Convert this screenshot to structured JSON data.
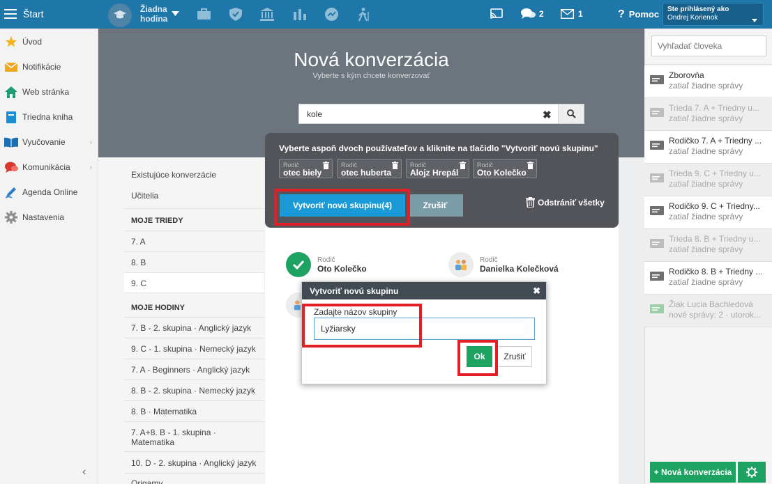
{
  "topbar": {
    "menu_label": "Štart",
    "hour_line1": "Žiadna",
    "hour_line2": "hodina",
    "messages_count": "2",
    "mail_count": "1",
    "help_label": "Pomoc",
    "user_caption": "Ste prihlásený ako",
    "user_name": "Ondrej Korienok"
  },
  "sidebar": {
    "items": [
      {
        "label": "Úvod",
        "icon": "star-icon"
      },
      {
        "label": "Notifikácie",
        "icon": "envelope-icon"
      },
      {
        "label": "Web stránka",
        "icon": "home-icon"
      },
      {
        "label": "Triedna kniha",
        "icon": "book-icon"
      },
      {
        "label": "Vyučovanie",
        "icon": "open-book-icon"
      },
      {
        "label": "Komunikácia",
        "icon": "chat-icon"
      },
      {
        "label": "Agenda Online",
        "icon": "pen-icon"
      },
      {
        "label": "Nastavenia",
        "icon": "gear-icon"
      }
    ]
  },
  "hero": {
    "title": "Nová konverzácia",
    "subtitle": "Vyberte s kým chcete konverzovať"
  },
  "search": {
    "value": "kole"
  },
  "left_list": {
    "existing": "Existujúce konverzácie",
    "teachers": "Učitelia",
    "classes_heading": "MOJE TRIEDY",
    "classes": [
      "7. A",
      "8. B",
      "9. C"
    ],
    "hours_heading": "MOJE HODINY",
    "hours": [
      "7. B - 2. skupina · Anglický jazyk",
      "9. C - 1. skupina · Nemecký jazyk",
      "7. A - Beginners · Anglický jazyk",
      "8. B - 2. skupina · Nemecký jazyk",
      "8. B · Matematika",
      "7. A+8. B - 1. skupina ·",
      "Matematika",
      "10. D - 2. skupina · Anglický jazyk",
      "Origamy"
    ]
  },
  "panel": {
    "instruction": "Vyberte aspoň dvoch používateľov a kliknite na tlačidlo \"Vytvoriť novú skupinu\"",
    "chips": [
      {
        "role": "Rodič",
        "name": "otec biely"
      },
      {
        "role": "Rodič",
        "name": "otec huberta"
      },
      {
        "role": "Rodič",
        "name": "Alojz Hrepál"
      },
      {
        "role": "Rodič",
        "name": "Oto Kolečko"
      }
    ],
    "create_label": "Vytvoriť novú skupinu(4)",
    "cancel_label": "Zrušiť",
    "remove_all_label": "Odstrániť všetky"
  },
  "contacts": [
    {
      "role": "Rodič",
      "name": "Oto Kolečko",
      "selected": true
    },
    {
      "role": "Rodič",
      "name": "Danielka Kolečková",
      "selected": false
    }
  ],
  "dialog": {
    "title": "Vytvoriť novú skupinu",
    "label": "Zadajte názov skupiny",
    "value": "Lyžiarsky",
    "ok_label": "Ok",
    "cancel_label": "Zrušiť"
  },
  "right_sidebar": {
    "search_placeholder": "Vyhľadať človeka",
    "conversations": [
      {
        "title": "Zborovňa",
        "sub": "zatiaľ žiadne správy",
        "dim": false
      },
      {
        "title": "Trieda 7. A + Triedny u...",
        "sub": "zatiaľ žiadne správy",
        "dim": true
      },
      {
        "title": "Rodičko 7. A + Triedny ...",
        "sub": "zatiaľ žiadne správy",
        "dim": false
      },
      {
        "title": "Trieda 9. C + Triedny u...",
        "sub": "zatiaľ žiadne správy",
        "dim": true
      },
      {
        "title": "Rodičko 9. C + Triedny...",
        "sub": "zatiaľ žiadne správy",
        "dim": false
      },
      {
        "title": "Trieda 8. B + Triedny u...",
        "sub": "zatiaľ žiadne správy",
        "dim": true
      },
      {
        "title": "Rodičko 8. B + Triedny ...",
        "sub": "zatiaľ žiadne správy",
        "dim": false
      },
      {
        "title": "Žiak Lucia Bachledová",
        "sub": "nové správy: 2 · utorok...",
        "dim": true
      }
    ],
    "new_conv_label": "+ Nová konverzácia"
  },
  "colors": {
    "topbar": "#1f76a8",
    "accent_blue": "#1a9ad6",
    "success_green": "#1ea262",
    "highlight_red": "#e41e26"
  }
}
